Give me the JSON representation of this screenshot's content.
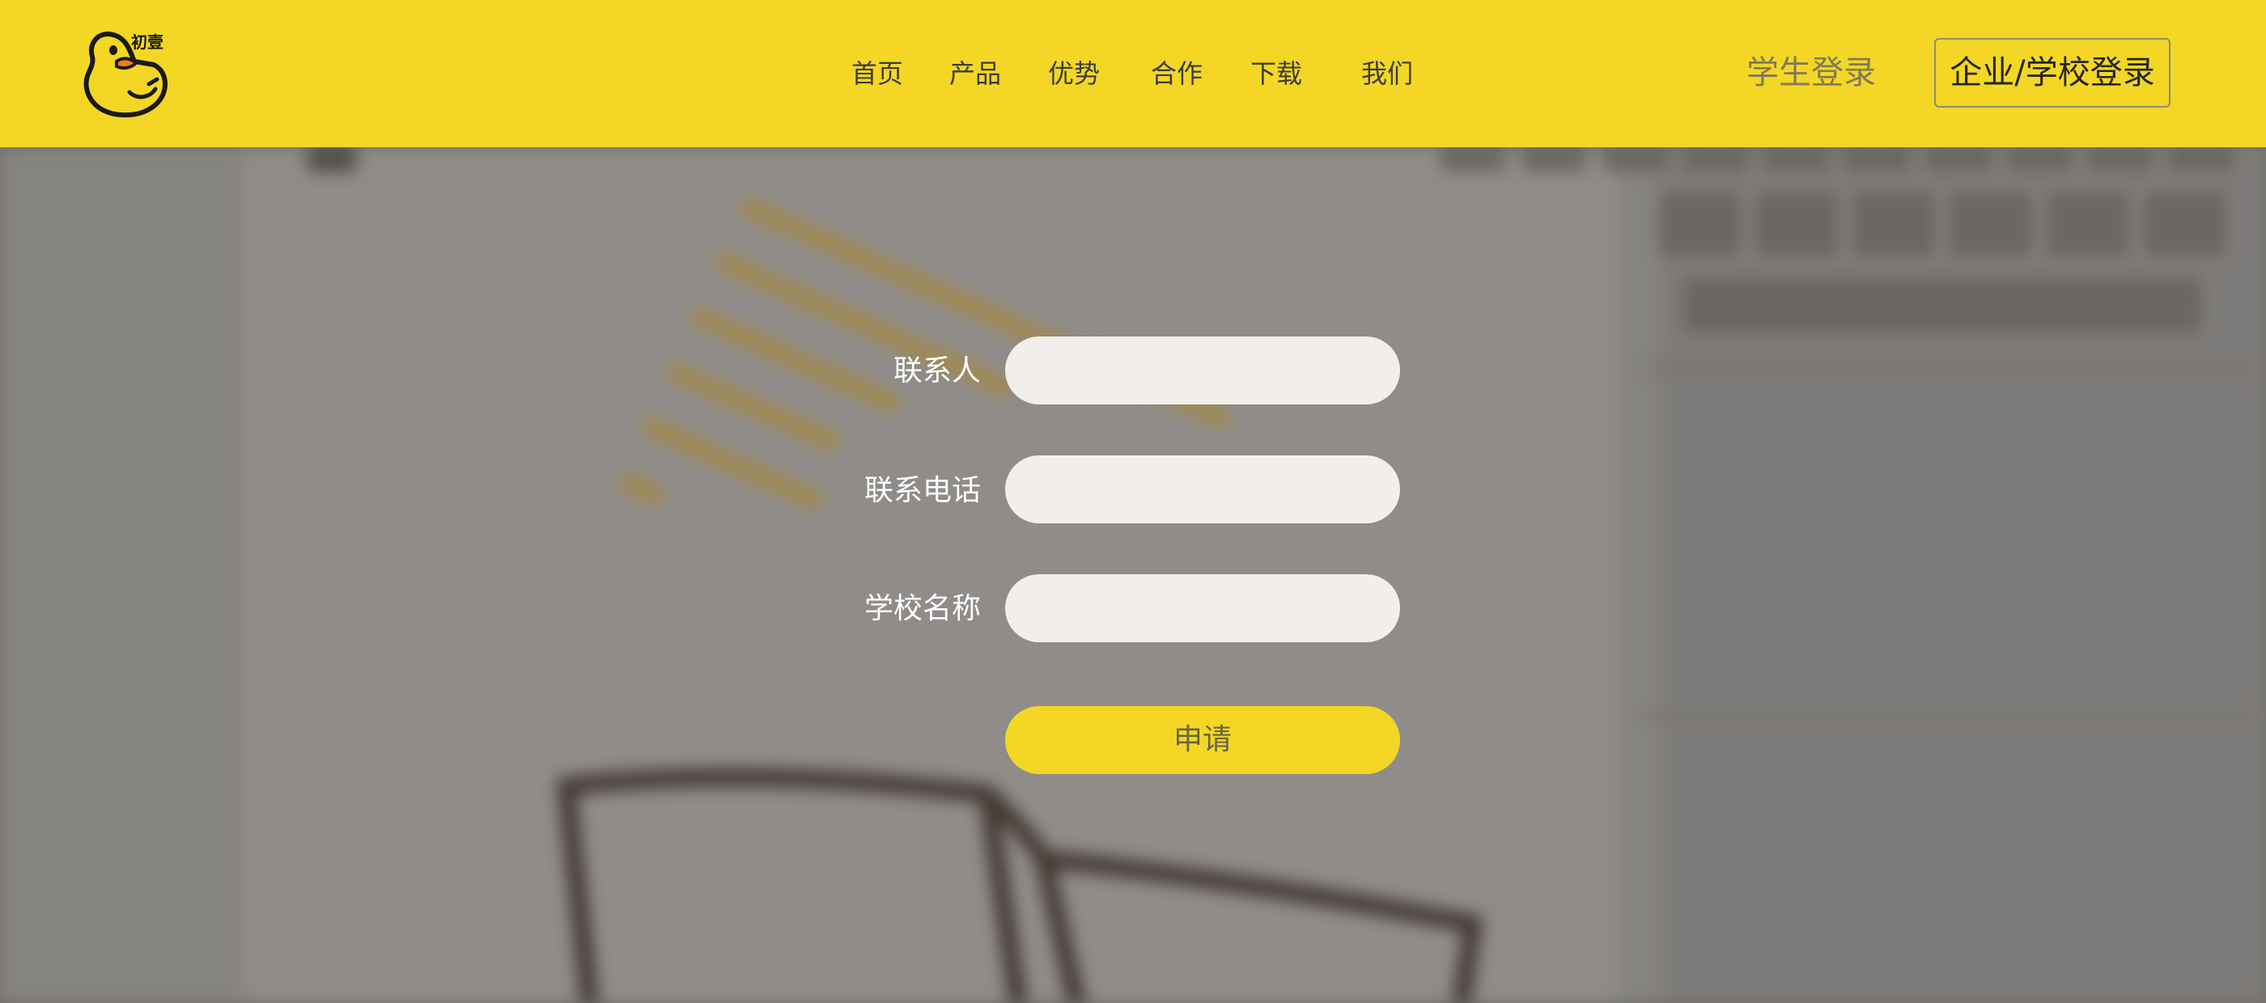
{
  "brand": {
    "logo_text": "初壹",
    "accent_color": "#f3d724"
  },
  "nav": {
    "items": [
      {
        "label": "首页"
      },
      {
        "label": "产品"
      },
      {
        "label": "优势"
      },
      {
        "label": "合作"
      },
      {
        "label": "下载"
      },
      {
        "label": "我们"
      }
    ]
  },
  "header": {
    "student_login_label": "学生登录",
    "org_login_label": "企业/学校登录"
  },
  "form": {
    "fields": [
      {
        "label": "联系人",
        "value": ""
      },
      {
        "label": "联系电话",
        "value": ""
      },
      {
        "label": "学校名称",
        "value": ""
      }
    ],
    "submit_label": "申请"
  },
  "icons": {
    "logo": "duck-logo-icon"
  }
}
